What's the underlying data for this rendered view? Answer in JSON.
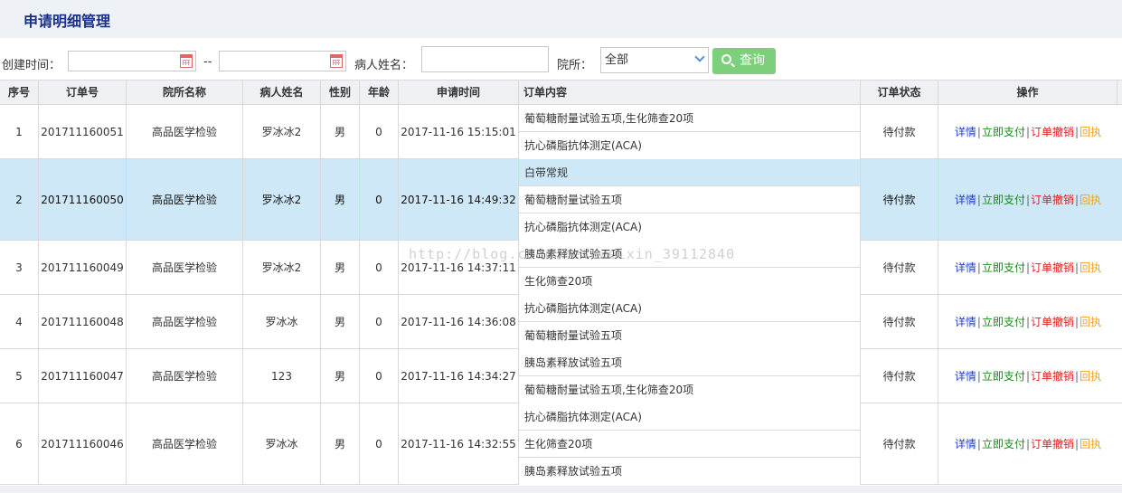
{
  "page": {
    "title": "申请明细管理"
  },
  "filter": {
    "created_label": "创建时间：",
    "date_sep": "--",
    "patient_label": "病人姓名：",
    "hospital_label": "院所：",
    "hospital_value": "全部",
    "search_label": "查询"
  },
  "table": {
    "headers": [
      "序号",
      "订单号",
      "院所名称",
      "病人姓名",
      "性别",
      "年龄",
      "申请时间",
      "订单内容",
      "订单状态",
      "操作"
    ],
    "actions": {
      "detail": "详情",
      "pay": "立即支付",
      "cancel": "订单撤销",
      "receipt": "回执",
      "sep": "|"
    },
    "rows": [
      {
        "no": "1",
        "order": "201711160051",
        "hospital": "高品医学检验",
        "patient": "罗冰冰2",
        "sex": "男",
        "age": "0",
        "time": "2017-11-16 15:15:01",
        "items": [
          "葡萄糖耐量试验五项,生化筛查20项",
          "抗心磷脂抗体测定(ACA)"
        ],
        "status": "待付款"
      },
      {
        "no": "2",
        "order": "201711160050",
        "hospital": "高品医学检验",
        "patient": "罗冰冰2",
        "sex": "男",
        "age": "0",
        "time": "2017-11-16 14:49:32",
        "items": [
          "白带常规",
          "葡萄糖耐量试验五项",
          "抗心磷脂抗体测定(ACA)"
        ],
        "status": "待付款"
      },
      {
        "no": "3",
        "order": "201711160049",
        "hospital": "高品医学检验",
        "patient": "罗冰冰2",
        "sex": "男",
        "age": "0",
        "time": "2017-11-16 14:37:11",
        "items": [
          "胰岛素释放试验五项",
          "生化筛查20项"
        ],
        "status": "待付款"
      },
      {
        "no": "4",
        "order": "201711160048",
        "hospital": "高品医学检验",
        "patient": "罗冰冰",
        "sex": "男",
        "age": "0",
        "time": "2017-11-16 14:36:08",
        "items": [
          "抗心磷脂抗体测定(ACA)",
          "葡萄糖耐量试验五项"
        ],
        "status": "待付款"
      },
      {
        "no": "5",
        "order": "201711160047",
        "hospital": "高品医学检验",
        "patient": "123",
        "sex": "男",
        "age": "0",
        "time": "2017-11-16 14:34:27",
        "items": [
          "胰岛素释放试验五项",
          "葡萄糖耐量试验五项,生化筛查20项"
        ],
        "status": "待付款"
      },
      {
        "no": "6",
        "order": "201711160046",
        "hospital": "高品医学检验",
        "patient": "罗冰冰",
        "sex": "男",
        "age": "0",
        "time": "2017-11-16 14:32:55",
        "items": [
          "抗心磷脂抗体测定(ACA)",
          "生化筛查20项",
          "胰岛素释放试验五项"
        ],
        "status": "待付款"
      }
    ]
  },
  "watermark": "http://blog.csdn.net/weixin_39112840"
}
